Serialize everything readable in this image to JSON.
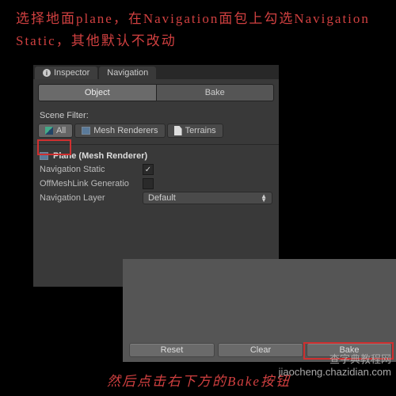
{
  "annotations": {
    "top": "选择地面plane，在Navigation面包上勾选Navigation Static，其他默认不改动",
    "bottom": "然后点击右下方的Bake按钮"
  },
  "watermark": {
    "site": "查字典教程网",
    "url": "jiaocheng.chazidian.com"
  },
  "tabs": {
    "inspector": "Inspector",
    "navigation": "Navigation"
  },
  "modes": {
    "object": "Object",
    "bake": "Bake"
  },
  "filter": {
    "label": "Scene Filter:",
    "all": "All",
    "mesh": "Mesh Renderers",
    "terrain": "Terrains"
  },
  "object": {
    "header": "Plane (Mesh Renderer)",
    "navStatic": "Navigation Static",
    "offMesh": "OffMeshLink Generatio",
    "navLayer": "Navigation Layer",
    "layerValue": "Default"
  },
  "buttons": {
    "reset": "Reset",
    "clear": "Clear",
    "bake": "Bake"
  }
}
